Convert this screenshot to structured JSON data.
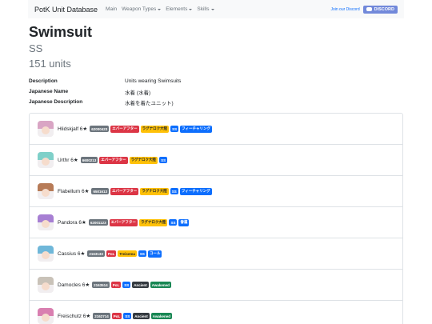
{
  "nav": {
    "brand": "PotK Unit Database",
    "main": "Main",
    "weapon_types": "Weapon Types",
    "elements": "Elements",
    "skills": "Skills",
    "join": "Join our Discord",
    "discord": "DISCORD"
  },
  "page": {
    "title": "Swimsuit",
    "subtitle": "SS",
    "count": "151 units"
  },
  "info": [
    {
      "label": "Description",
      "value": "Units wearing Swimsuits"
    },
    {
      "label": "Japanese Name",
      "value": "水着 (水着)"
    },
    {
      "label": "Japanese Description",
      "value": "水着を着たユニット)"
    }
  ],
  "units": [
    {
      "name": "Hlidskjalf 6★",
      "hair": "#d9a5c4",
      "badges": [
        {
          "text": "62000423",
          "kind": "id"
        },
        {
          "text": "エバーアフター",
          "kind": "red"
        },
        {
          "text": "ラグナロク大陸",
          "kind": "yellow"
        },
        {
          "text": "SS",
          "kind": "blue"
        },
        {
          "text": "フィーチャリング",
          "kind": "blue"
        }
      ]
    },
    {
      "name": "Urthr 6★",
      "hair": "#7fd0c9",
      "badges": [
        {
          "text": "6600213",
          "kind": "id"
        },
        {
          "text": "エバーアフター",
          "kind": "red"
        },
        {
          "text": "ラグナロク大陸",
          "kind": "yellow"
        },
        {
          "text": "SS",
          "kind": "blue"
        }
      ]
    },
    {
      "name": "Flabellum 6★",
      "hair": "#b77b57",
      "badges": [
        {
          "text": "6501613",
          "kind": "id"
        },
        {
          "text": "エバーアフター",
          "kind": "red"
        },
        {
          "text": "ラグナロク大陸",
          "kind": "yellow"
        },
        {
          "text": "SS",
          "kind": "blue"
        },
        {
          "text": "フィーチャリング",
          "kind": "blue"
        }
      ]
    },
    {
      "name": "Pandora 6★",
      "hair": "#a77fd3",
      "badges": [
        {
          "text": "62001123",
          "kind": "id"
        },
        {
          "text": "エバーアフター",
          "kind": "red"
        },
        {
          "text": "ラグナロク大陸",
          "kind": "yellow"
        },
        {
          "text": "SS",
          "kind": "blue"
        },
        {
          "text": "眷属",
          "kind": "blue"
        }
      ]
    },
    {
      "name": "Cassius 6★",
      "hair": "#6fb7d9",
      "badges": [
        {
          "text": "2163133",
          "kind": "id"
        },
        {
          "text": "PoL",
          "kind": "red"
        },
        {
          "text": "Treisema",
          "kind": "yellow"
        },
        {
          "text": "SS",
          "kind": "blue"
        },
        {
          "text": "コール",
          "kind": "blue"
        }
      ]
    },
    {
      "name": "Damocles 6★",
      "hair": "#c9c2b8",
      "badges": [
        {
          "text": "2163514",
          "kind": "id"
        },
        {
          "text": "PoL",
          "kind": "red"
        },
        {
          "text": "SS",
          "kind": "blue"
        },
        {
          "text": "Ancient",
          "kind": "dark"
        },
        {
          "text": "Awakened",
          "kind": "green"
        }
      ]
    },
    {
      "name": "Freischutz 6★",
      "hair": "#d97fb0",
      "badges": [
        {
          "text": "2162714",
          "kind": "id"
        },
        {
          "text": "PoL",
          "kind": "red"
        },
        {
          "text": "SS",
          "kind": "blue"
        },
        {
          "text": "Ancient",
          "kind": "dark"
        },
        {
          "text": "Awakened",
          "kind": "green"
        }
      ]
    }
  ]
}
